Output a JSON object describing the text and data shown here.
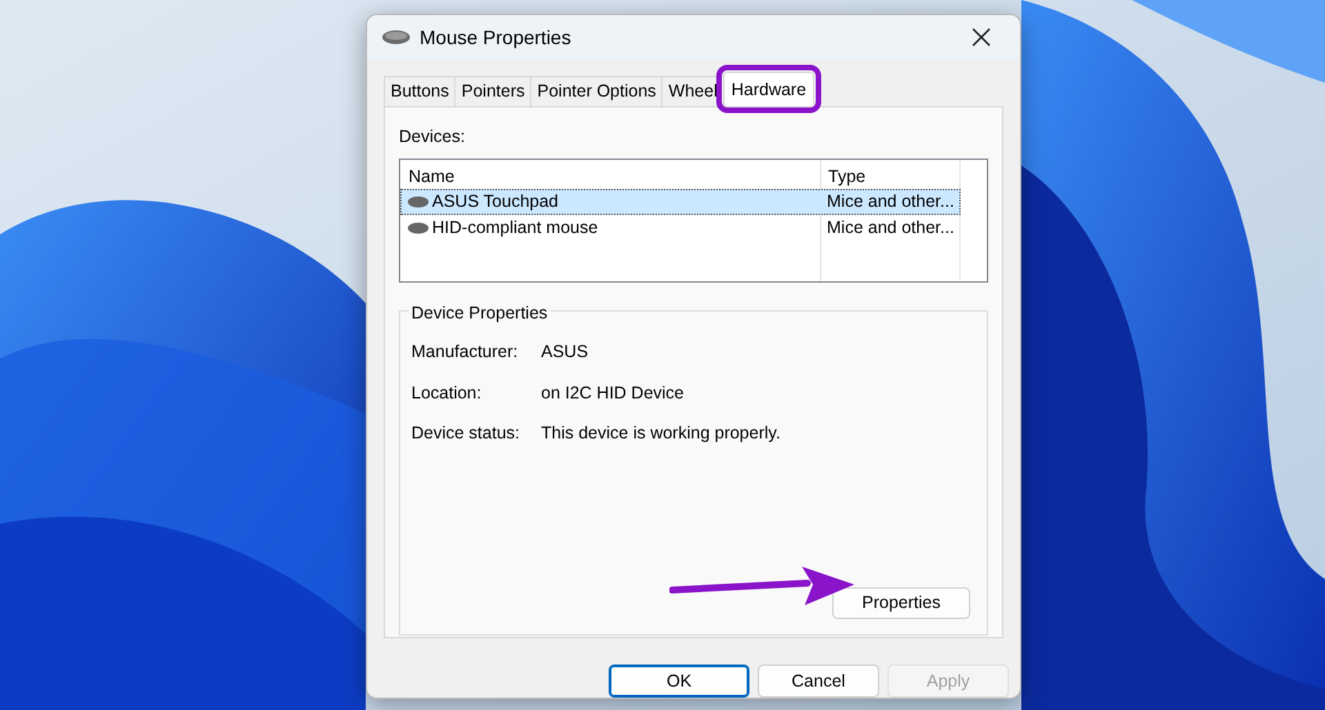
{
  "window": {
    "title": "Mouse Properties"
  },
  "tabs": [
    {
      "label": "Buttons",
      "selected": false,
      "highlighted": false
    },
    {
      "label": "Pointers",
      "selected": false,
      "highlighted": false
    },
    {
      "label": "Pointer Options",
      "selected": false,
      "highlighted": false
    },
    {
      "label": "Wheel",
      "selected": false,
      "highlighted": false
    },
    {
      "label": "Hardware",
      "selected": true,
      "highlighted": true
    }
  ],
  "devices": {
    "label": "Devices:",
    "columns": [
      "Name",
      "Type"
    ],
    "rows": [
      {
        "name": "ASUS Touchpad",
        "type": "Mice and other...",
        "selected": true
      },
      {
        "name": "HID-compliant mouse",
        "type": "Mice and other...",
        "selected": false
      }
    ]
  },
  "device_properties": {
    "title": "Device Properties",
    "fields": [
      {
        "label": "Manufacturer:",
        "value": "ASUS"
      },
      {
        "label": "Location:",
        "value": "on I2C HID Device"
      },
      {
        "label": "Device status:",
        "value": "This device is working properly."
      }
    ],
    "button": {
      "label": "Properties",
      "arrow": true
    }
  },
  "buttons": [
    {
      "label": "OK",
      "kind": "default",
      "disabled": false
    },
    {
      "label": "Cancel",
      "kind": "normal",
      "disabled": false
    },
    {
      "label": "Apply",
      "kind": "normal",
      "disabled": true
    }
  ]
}
